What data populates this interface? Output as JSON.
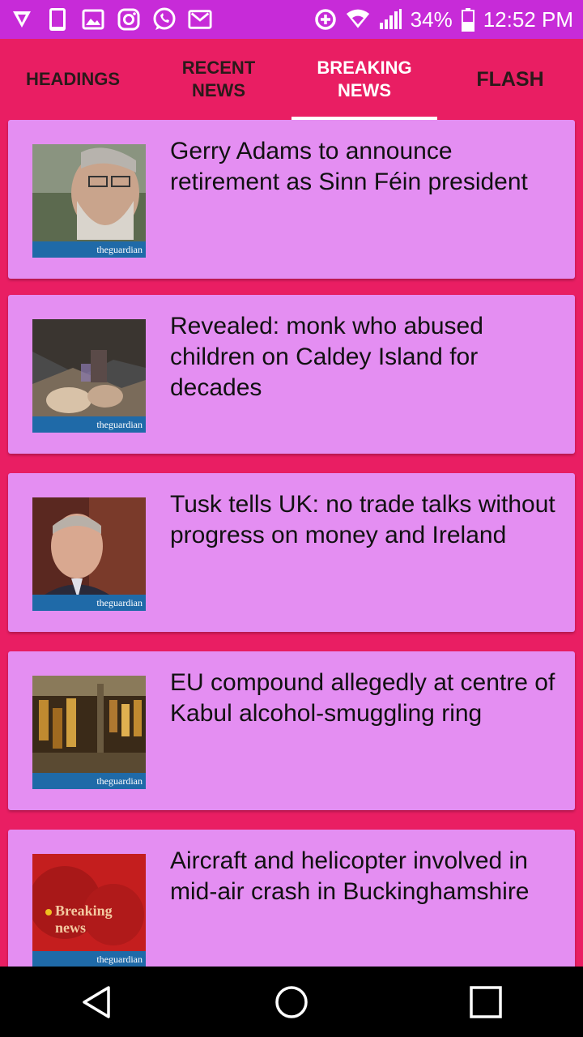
{
  "status_bar": {
    "left_icons": [
      "shield-icon",
      "phone-icon",
      "gallery-icon",
      "instagram-icon",
      "whatsapp-icon",
      "gmail-icon"
    ],
    "right_icons": [
      "data-saver-icon",
      "wifi-icon",
      "signal-icon",
      "battery-icon"
    ],
    "battery": "34%",
    "time": "12:52 PM"
  },
  "tabs": [
    {
      "label": "HEADINGS",
      "active": false
    },
    {
      "label": "RECENT NEWS",
      "active": false
    },
    {
      "label": "BREAKING NEWS",
      "active": true
    },
    {
      "label": "FLASH",
      "active": false
    }
  ],
  "articles": [
    {
      "headline": "Gerry Adams to announce retirement as Sinn Féin president",
      "thumb_source": "theguardian"
    },
    {
      "headline": "Revealed: monk who abused children on Caldey Island for decades",
      "thumb_source": "theguardian"
    },
    {
      "headline": "Tusk tells UK: no trade talks without progress on money and Ireland",
      "thumb_source": "theguardian"
    },
    {
      "headline": "EU compound allegedly at centre of Kabul alcohol-smuggling ring",
      "thumb_source": "theguardian"
    },
    {
      "headline": "Aircraft and helicopter involved in mid-air crash in Buckinghamshire",
      "thumb_source": "theguardian",
      "thumb_text": "Breaking news"
    }
  ],
  "nav": {
    "icons": [
      "back-icon",
      "home-icon",
      "recents-icon"
    ]
  },
  "colors": {
    "status_bar": "#c72bd8",
    "tab_bar": "#e91e63",
    "card": "#e48ef2",
    "banner": "#1f6aa8"
  }
}
